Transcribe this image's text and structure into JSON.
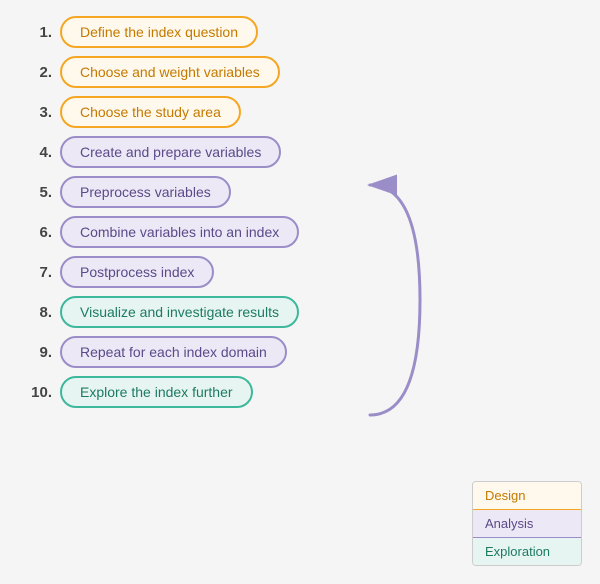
{
  "steps": [
    {
      "number": "1.",
      "label": "Define the index question",
      "type": "design"
    },
    {
      "number": "2.",
      "label": "Choose and weight variables",
      "type": "design"
    },
    {
      "number": "3.",
      "label": "Choose the study area",
      "type": "design"
    },
    {
      "number": "4.",
      "label": "Create and prepare variables",
      "type": "analysis"
    },
    {
      "number": "5.",
      "label": "Preprocess variables",
      "type": "analysis"
    },
    {
      "number": "6.",
      "label": "Combine variables into an index",
      "type": "analysis"
    },
    {
      "number": "7.",
      "label": "Postprocess index",
      "type": "analysis"
    },
    {
      "number": "8.",
      "label": "Visualize and investigate results",
      "type": "exploration"
    },
    {
      "number": "9.",
      "label": "Repeat for each index domain",
      "type": "analysis"
    },
    {
      "number": "10.",
      "label": "Explore the index further",
      "type": "exploration"
    }
  ],
  "legend": {
    "design_label": "Design",
    "analysis_label": "Analysis",
    "exploration_label": "Exploration"
  }
}
